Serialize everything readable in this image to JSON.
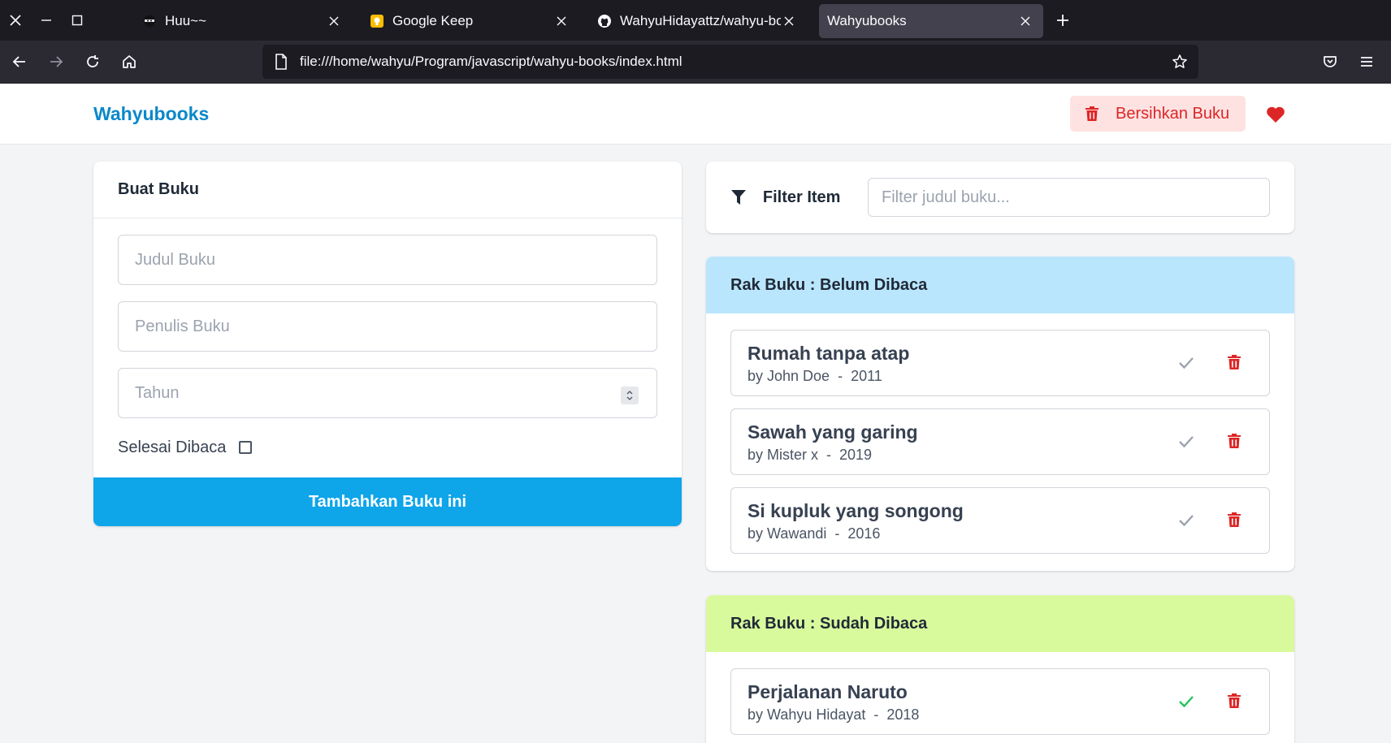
{
  "browser": {
    "tabs": [
      {
        "title": "Huu~~",
        "active": false
      },
      {
        "title": "Google Keep",
        "active": false
      },
      {
        "title": "WahyuHidayattz/wahyu-bo",
        "active": false
      },
      {
        "title": "Wahyubooks",
        "active": true
      }
    ],
    "url": "file:///home/wahyu/Program/javascript/wahyu-books/index.html"
  },
  "header": {
    "brand": "Wahyubooks",
    "clear_label": "Bersihkan Buku"
  },
  "create": {
    "title": "Buat Buku",
    "title_placeholder": "Judul Buku",
    "author_placeholder": "Penulis Buku",
    "year_placeholder": "Tahun",
    "done_label": "Selesai Dibaca",
    "submit_label": "Tambahkan Buku ini"
  },
  "filter": {
    "label": "Filter Item",
    "placeholder": "Filter judul buku..."
  },
  "shelves": {
    "unread": {
      "title": "Rak Buku : Belum Dibaca",
      "books": [
        {
          "title": "Rumah tanpa atap",
          "meta": "by John Doe  -  2011"
        },
        {
          "title": "Sawah yang garing",
          "meta": "by Mister x  -  2019"
        },
        {
          "title": "Si kupluk yang songong",
          "meta": "by Wawandi  -  2016"
        }
      ]
    },
    "read": {
      "title": "Rak Buku : Sudah Dibaca",
      "books": [
        {
          "title": "Perjalanan Naruto",
          "meta": "by Wahyu Hidayat  -  2018"
        }
      ]
    }
  },
  "colors": {
    "brand": "#0b88c9",
    "primary": "#0ea5e9",
    "danger": "#dc2626",
    "unread_header": "#bae6fd",
    "read_header": "#d9f99d",
    "check_done": "#22c55e",
    "check_pending": "#9ca3af"
  }
}
